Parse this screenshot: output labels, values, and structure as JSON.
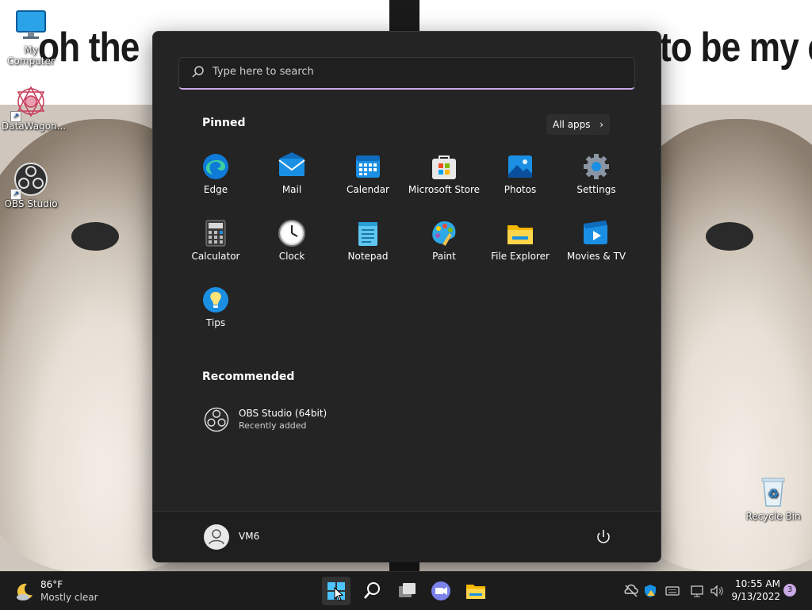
{
  "wallpaper": {
    "text_left": "oh the",
    "text_right": "to be my ene"
  },
  "desktop_icons": [
    {
      "label": "My Computer",
      "icon": "monitor-icon"
    },
    {
      "label": "DataWagon...",
      "icon": "datawagon-icon"
    },
    {
      "label": "OBS Studio",
      "icon": "obs-icon"
    },
    {
      "label": "Recycle Bin",
      "icon": "recycle-bin-icon"
    }
  ],
  "start_menu": {
    "search_placeholder": "Type here to search",
    "pinned_title": "Pinned",
    "all_apps_label": "All apps",
    "pinned_apps": [
      {
        "label": "Edge",
        "icon": "edge-icon"
      },
      {
        "label": "Mail",
        "icon": "mail-icon"
      },
      {
        "label": "Calendar",
        "icon": "calendar-icon"
      },
      {
        "label": "Microsoft Store",
        "icon": "store-icon"
      },
      {
        "label": "Photos",
        "icon": "photos-icon"
      },
      {
        "label": "Settings",
        "icon": "settings-icon"
      },
      {
        "label": "Calculator",
        "icon": "calculator-icon"
      },
      {
        "label": "Clock",
        "icon": "clock-icon"
      },
      {
        "label": "Notepad",
        "icon": "notepad-icon"
      },
      {
        "label": "Paint",
        "icon": "paint-icon"
      },
      {
        "label": "File Explorer",
        "icon": "file-explorer-icon"
      },
      {
        "label": "Movies & TV",
        "icon": "movies-tv-icon"
      },
      {
        "label": "Tips",
        "icon": "tips-icon"
      }
    ],
    "recommended_title": "Recommended",
    "recommended": [
      {
        "title": "OBS Studio (64bit)",
        "subtitle": "Recently added",
        "icon": "obs-icon"
      }
    ],
    "user_name": "VM6"
  },
  "taskbar": {
    "weather_temp": "86°F",
    "weather_desc": "Mostly clear",
    "apps": [
      "start-icon",
      "search-icon",
      "task-view-icon",
      "teams-chat-icon",
      "file-explorer-icon"
    ],
    "clock_time": "10:55 AM",
    "clock_date": "9/13/2022",
    "notification_count": "3"
  },
  "colors": {
    "start_bg": "#242424",
    "taskbar_bg": "#1c1c1c",
    "accent": "#c9a9e6",
    "windows_blue": "#0078d4"
  }
}
